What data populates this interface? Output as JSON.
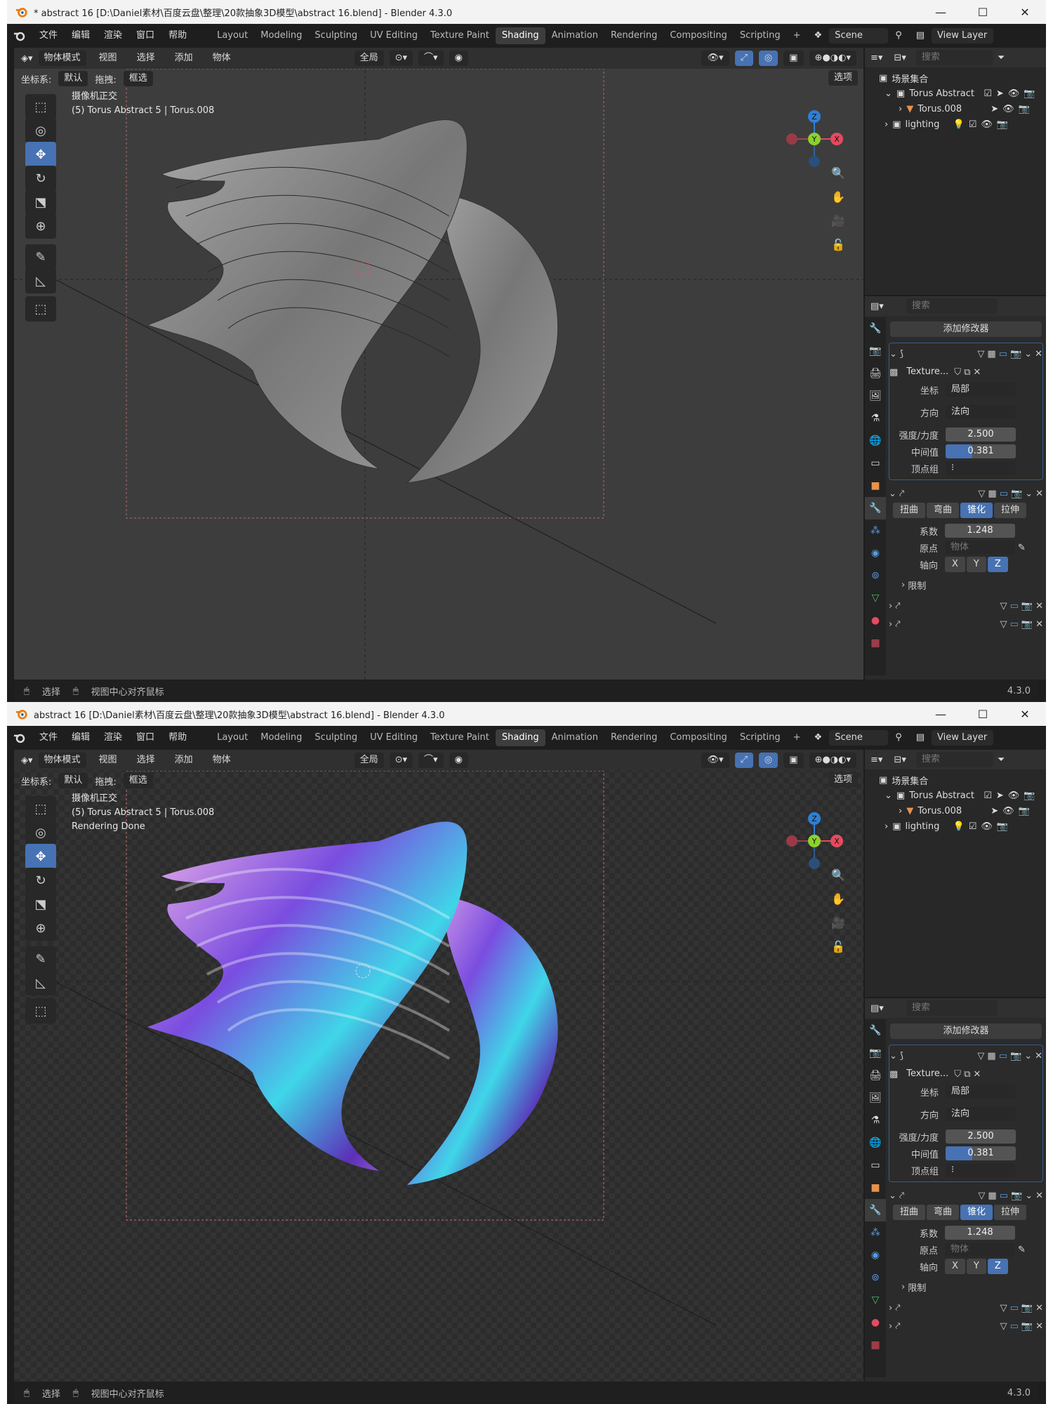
{
  "windows": [
    {
      "title": "* abstract 16 [D:\\Daniel素材\\百度云盘\\整理\\20款抽象3D模型\\abstract 16.blend] - Blender 4.3.0",
      "overlay_lines": [
        "摄像机正交",
        "(5) Torus Abstract 5 | Torus.008",
        ""
      ],
      "render_state": "wireframe"
    },
    {
      "title": "abstract 16 [D:\\Daniel素材\\百度云盘\\整理\\20款抽象3D模型\\abstract 16.blend] - Blender 4.3.0",
      "overlay_lines": [
        "摄像机正交",
        "(5) Torus Abstract 5 | Torus.008",
        "Rendering Done"
      ],
      "render_state": "rendered"
    }
  ],
  "window_controls": {
    "minimize": "—",
    "maximize": "☐",
    "close": "✕"
  },
  "menu": {
    "items": [
      "文件",
      "编辑",
      "渲染",
      "窗口",
      "帮助"
    ]
  },
  "workspaces": {
    "tabs": [
      "Layout",
      "Modeling",
      "Sculpting",
      "UV Editing",
      "Texture Paint",
      "Shading",
      "Animation",
      "Rendering",
      "Compositing",
      "Scripting"
    ],
    "active": "Shading",
    "add": "+"
  },
  "scene": {
    "name": "Scene",
    "view_layer": "View Layer"
  },
  "viewport_header": {
    "mode": "物体模式",
    "menus": [
      "视图",
      "选择",
      "添加",
      "物体"
    ],
    "transform": "全局",
    "coord_label": "坐标系:",
    "coord_value": "默认",
    "drag_label": "拖拽:",
    "drag_value": "框选",
    "options": "选项"
  },
  "gizmo": {
    "z": "Z",
    "y": "Y",
    "x": "X"
  },
  "statusbar": {
    "select": "选择",
    "center": "视图中心对齐鼠标",
    "version": "4.3.0"
  },
  "outliner": {
    "search_placeholder": "搜索",
    "root": "场景集合",
    "items": [
      {
        "label": "Torus Abstract",
        "depth": 1
      },
      {
        "label": "Torus.008",
        "depth": 2
      },
      {
        "label": "lighting",
        "depth": 1
      }
    ]
  },
  "properties": {
    "search_placeholder": "搜索",
    "add_modifier": "添加修改器",
    "displace": {
      "texture": "Texture...",
      "coords_label": "坐标",
      "coords_value": "局部",
      "direction_label": "方向",
      "direction_value": "法向",
      "strength_label": "强度/力度",
      "strength_value": "2.500",
      "midlevel_label": "中间值",
      "midlevel_value": "0.381",
      "midlevel_fraction": 0.381,
      "vgroup_label": "顶点组"
    },
    "deform": {
      "modes": [
        "扭曲",
        "弯曲",
        "锥化",
        "拉伸"
      ],
      "active_mode": "锥化",
      "factor_label": "系数",
      "factor_value": "1.248",
      "origin_label": "原点",
      "origin_placeholder": "物体",
      "axis_label": "轴向",
      "axes": [
        "X",
        "Y",
        "Z"
      ],
      "active_axis": "Z",
      "limits": "限制"
    }
  },
  "colors": {
    "accent": "#4772b3",
    "gizmo_x": "#e44b5f",
    "gizmo_y": "#8cd12c",
    "gizmo_z": "#2f7fd6"
  }
}
